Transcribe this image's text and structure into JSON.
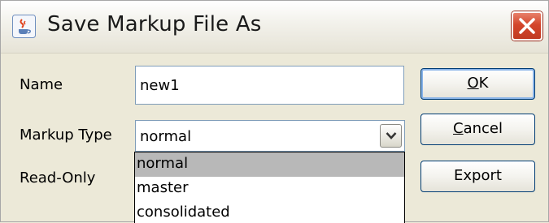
{
  "window": {
    "title": "Save Markup File As",
    "app_icon": "java-cup-icon",
    "close_icon": "close-icon",
    "close_color": "#d3462c"
  },
  "form": {
    "name_label": "Name",
    "name_value": "new1",
    "markup_type_label": "Markup Type",
    "markup_type_value": "normal",
    "read_only_label": "Read-Only"
  },
  "dropdown": {
    "options": [
      "normal",
      "master",
      "consolidated"
    ],
    "selected": "normal",
    "highlight_color": "#b8b8b8"
  },
  "buttons": {
    "ok_mnemonic": "O",
    "ok_rest": "K",
    "cancel_mnemonic": "C",
    "cancel_rest": "ancel",
    "export_label": "Export"
  }
}
